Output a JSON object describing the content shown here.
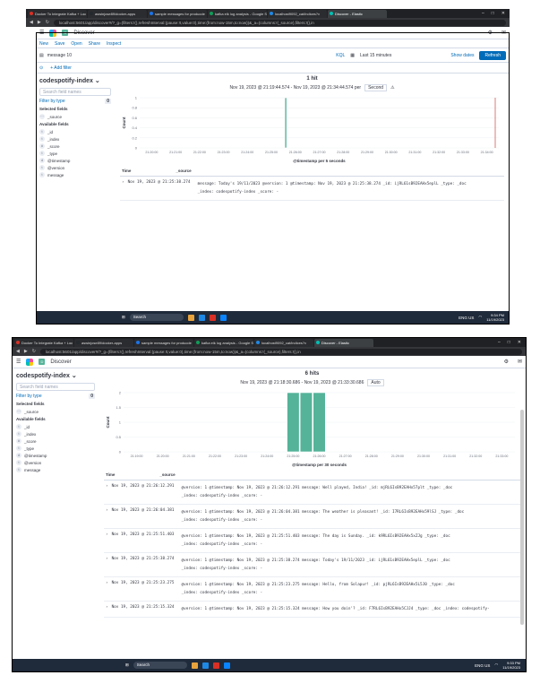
{
  "browser": {
    "tabs": [
      "Docker To Integrate Kafka + Loc",
      "aswinjose89/docker-apps",
      "sample messages for producde",
      "kafka elk log analysis - Google S",
      "localhost9092_cat/indices?v",
      "Discover - Elastic"
    ],
    "url1": "localhost:5601/app/discover#/?_g=(filters:!(),refreshInterval:(pause:!t,value:0),time:(from:now-15m,to:now))&_a=(columns:!(_source),filters:!(),in",
    "url2": "localhost:5601/app/discover#/?_g=(filters:!(),refreshInterval:(pause:!t,value:0),time:(from:now-15m,to:now))&_a=(columns:!(_source),filters:!(),in"
  },
  "kibana": {
    "app_title": "Discover",
    "nav": [
      "New",
      "Save",
      "Open",
      "Share",
      "Inspect"
    ],
    "query": "message 10",
    "kql": "KQL",
    "timepicker": "Last 15 minutes",
    "show_dates": "Show dates",
    "refresh": "Refresh",
    "add_filter": "+ Add filter",
    "index": "codespotify-index",
    "search_placeholder": "Search field names",
    "filter_by_type": "Filter by type",
    "filter_count": "0",
    "selected_fields": "Selected fields",
    "available_fields": "Available fields",
    "source_field": "_source"
  },
  "s1": {
    "hits": "1 hit",
    "range": "Nov 19, 2023 @ 21:19:44.574 - Nov 19, 2023 @ 21:34:44.574 per",
    "interval": "Second",
    "chart_title": "@timestamp per 5 seconds",
    "ylabel": "Count",
    "fields": [
      {
        "tok": "t",
        "name": "_id"
      },
      {
        "tok": "t",
        "name": "_index"
      },
      {
        "tok": "#",
        "name": "_score"
      },
      {
        "tok": "t",
        "name": "_type"
      },
      {
        "tok": "d",
        "name": "@timestamp"
      },
      {
        "tok": "t",
        "name": "@version"
      },
      {
        "tok": "t",
        "name": "message"
      }
    ],
    "head_time": "Time",
    "head_source": "_source",
    "rows": [
      {
        "time": "Nov 19, 2023 @ 21:25:38.274",
        "line1": "message: Today's 19/11/2023 @version: 1 @timestamp: Nov 19, 2023 @ 21:25:38.274 _id: ijRL61sB92EAHx5eplL _type: _doc",
        "line2": "_index: codespotify-index _score: -"
      }
    ],
    "clock_time": "9:34 PM",
    "clock_date": "11/19/2023",
    "taskbar_search": "Search",
    "lang": "ENG US"
  },
  "s2": {
    "hits": "6 hits",
    "range": "Nov 19, 2023 @ 21:18:30.686 - Nov 19, 2023 @ 21:33:30.686",
    "interval": "Auto",
    "chart_title": "@timestamp per 30 seconds",
    "ylabel": "Count",
    "fields": [
      {
        "tok": "t",
        "name": "_id"
      },
      {
        "tok": "t",
        "name": "_index"
      },
      {
        "tok": "#",
        "name": "_score"
      },
      {
        "tok": "t",
        "name": "_type"
      },
      {
        "tok": "d",
        "name": "@timestamp"
      },
      {
        "tok": "t",
        "name": "@version"
      },
      {
        "tok": "t",
        "name": "message"
      }
    ],
    "head_time": "Time",
    "head_source": "_source",
    "rows": [
      {
        "time": "Nov 19, 2023 @ 21:26:12.291",
        "line1": "@version: 1 @timestamp: Nov 19, 2023 @ 21:26:12.291 message: Well played, India! _id: mjRL6IsB92EAHx57plt _type: _doc",
        "line2": "_index: codespotify-index _score: -"
      },
      {
        "time": "Nov 19, 2023 @ 21:26:04.381",
        "line1": "@version: 1 @timestamp: Nov 19, 2023 @ 21:26:04.381 message: The weather is pleasant! _id: I7RL6IsB92EAHx59lSJ _type: _doc",
        "line2": "_index: codespotify-index _score: -"
      },
      {
        "time": "Nov 19, 2023 @ 21:25:51.403",
        "line1": "@version: 1 @timestamp: Nov 19, 2023 @ 21:25:51.403 message: The day is Sunday. _id: k9RL6IsB92EAHx5xZJg _type: _doc",
        "line2": "_index: codespotify-index _score: -"
      },
      {
        "time": "Nov 19, 2023 @ 21:25:38.274",
        "line1": "@version: 1 @timestamp: Nov 19, 2023 @ 21:25:38.274 message: Today's 19/11/2023 _id: ijRL61sB92EAHx5eplL _type: _doc",
        "line2": "_index: codespotify-index _score: -"
      },
      {
        "time": "Nov 19, 2023 @ 21:25:23.275",
        "line1": "@version: 1 @timestamp: Nov 19, 2023 @ 21:25:23.275 message: Hello, from Solapur! _id: pjRL6IsB92EAHx5L5J0 _type: _doc",
        "line2": "_index: codespotify-index _score: -"
      },
      {
        "time": "Nov 19, 2023 @ 21:25:15.324",
        "line1": "@version: 1 @timestamp: Nov 19, 2023 @ 21:25:15.324 message: How you doin'? _id: F7RL6IsB92EAHx5CJJ4 _type: _doc _index: codespotify-",
        "line2": ""
      }
    ],
    "clock_time": "9:33 PM",
    "clock_date": "11/19/2023",
    "taskbar_search": "Search",
    "lang": "ENG US"
  },
  "chart_data": [
    {
      "type": "bar",
      "title": "@timestamp per 5 seconds",
      "ylabel": "Count",
      "ylim": [
        0,
        1
      ],
      "yticks": [
        "0",
        "0.2",
        "0.4",
        "0.6",
        "0.8",
        "1"
      ],
      "x": [
        "21:20:00",
        "21:21:00",
        "21:22:00",
        "21:23:00",
        "21:24:00",
        "21:25:00",
        "21:26:00",
        "21:27:00",
        "21:28:00",
        "21:29:00",
        "21:30:00",
        "21:31:00",
        "21:32:00",
        "21:33:00",
        "21:34:00"
      ],
      "series": [
        {
          "values": [
            {
              "t": 5.6,
              "v": 1
            }
          ]
        }
      ]
    },
    {
      "type": "bar",
      "title": "@timestamp per 30 seconds",
      "ylabel": "Count",
      "ylim": [
        0,
        2
      ],
      "yticks": [
        "0",
        "0.5",
        "1",
        "1.5",
        "2"
      ],
      "x": [
        "21:19:00",
        "21:20:00",
        "21:21:00",
        "21:22:00",
        "21:23:00",
        "21:24:00",
        "21:25:00",
        "21:26:00",
        "21:27:00",
        "21:28:00",
        "21:29:00",
        "21:30:00",
        "21:31:00",
        "21:32:00",
        "21:33:00"
      ],
      "series": [
        {
          "values": [
            {
              "t": 6.0,
              "v": 2
            },
            {
              "t": 6.5,
              "v": 2
            },
            {
              "t": 7.0,
              "v": 2
            }
          ]
        }
      ]
    }
  ]
}
